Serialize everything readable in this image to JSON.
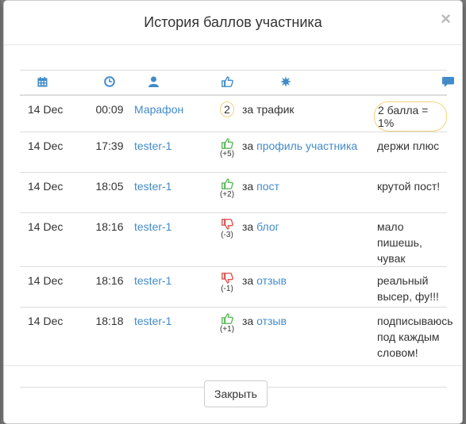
{
  "modal": {
    "title": "История баллов участника",
    "close_glyph": "×",
    "footer_button": "Закрыть"
  },
  "columns": {
    "date_icon": "calendar-icon",
    "time_icon": "clock-icon",
    "user_icon": "user-icon",
    "score_icon": "thumbs-up-icon",
    "reason_icon": "star-icon",
    "comment_icon": "comment-icon"
  },
  "colors": {
    "accent": "#428bca",
    "positive": "#5cb85c",
    "negative": "#d9534f",
    "highlight": "#f3d27a"
  },
  "rows": [
    {
      "date": "14 Dec",
      "time": "00:09",
      "user": "Марафон",
      "score": "2",
      "points": "",
      "reason_prefix": "за трафик",
      "reason_link": "",
      "comment": "2 балла = 1%"
    },
    {
      "date": "14 Dec",
      "time": "17:39",
      "user": "tester-1",
      "score": "up",
      "points": "(+5)",
      "reason_prefix": "за",
      "reason_link": "профиль участника",
      "comment": "держи плюс"
    },
    {
      "date": "14 Dec",
      "time": "18:05",
      "user": "tester-1",
      "score": "up",
      "points": "(+2)",
      "reason_prefix": "за",
      "reason_link": "пост",
      "comment": "крутой пост!"
    },
    {
      "date": "14 Dec",
      "time": "18:16",
      "user": "tester-1",
      "score": "down",
      "points": "(-3)",
      "reason_prefix": "за",
      "reason_link": "блог",
      "comment": "мало пишешь, чувак"
    },
    {
      "date": "14 Dec",
      "time": "18:16",
      "user": "tester-1",
      "score": "down",
      "points": "(-1)",
      "reason_prefix": "за",
      "reason_link": "отзыв",
      "comment": "реальный высер, фу!!!"
    },
    {
      "date": "14 Dec",
      "time": "18:18",
      "user": "tester-1",
      "score": "up",
      "points": "(+1)",
      "reason_prefix": "за",
      "reason_link": "отзыв",
      "comment": "подписываюсь под каждым словом!"
    }
  ]
}
